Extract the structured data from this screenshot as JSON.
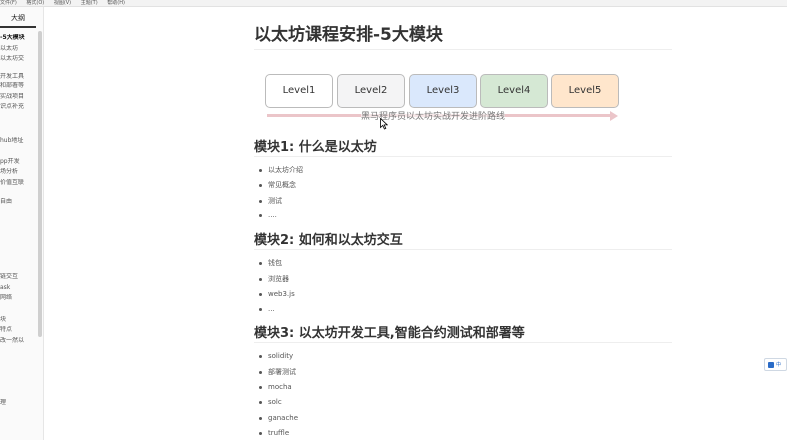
{
  "menubar": {
    "items": [
      "文件(F)",
      "格式(O)",
      "视图(V)",
      "主题(T)",
      "帮助(H)"
    ]
  },
  "sidebar": {
    "tab_label": "大纲",
    "items": [
      {
        "label": "-5大模块",
        "active": true
      },
      {
        "label": "以太坊"
      },
      {
        "label": "以太坊交"
      },
      {
        "label": "开发工具"
      },
      {
        "label": "和部署等"
      },
      {
        "label": "实战项目"
      },
      {
        "label": "识点补充"
      },
      {
        "label": "hub地址"
      },
      {
        "label": "pp开发"
      },
      {
        "label": "场分析"
      },
      {
        "label": "价值互联"
      },
      {
        "label": "自由"
      },
      {
        "label": "链交互"
      },
      {
        "label": "ask"
      },
      {
        "label": "网络"
      },
      {
        "label": "块"
      },
      {
        "label": "特点"
      },
      {
        "label": "改一然以"
      },
      {
        "label": "理"
      }
    ]
  },
  "document": {
    "title": "以太坊课程安排-5大模块",
    "levels": [
      {
        "label": "Level1",
        "color": "#ffffff"
      },
      {
        "label": "Level2",
        "color": "#f4f4f5"
      },
      {
        "label": "Level3",
        "color": "#dae8fc"
      },
      {
        "label": "Level4",
        "color": "#d5e8d4"
      },
      {
        "label": "Level5",
        "color": "#ffe6cc"
      }
    ],
    "arrow_text": "黑马程序员以太坊实战开发进阶路线",
    "modules": [
      {
        "heading": "模块1: 什么是以太坊",
        "items": [
          "以太坊介绍",
          "常见概念",
          "测试",
          "...."
        ]
      },
      {
        "heading": "模块2: 如何和以太坊交互",
        "items": [
          "钱包",
          "浏览器",
          "web3.js",
          "..."
        ]
      },
      {
        "heading": "模块3: 以太坊开发工具,智能合约测试和部署等",
        "items": [
          "solidity",
          "部署测试",
          "mocha",
          "solc",
          "ganache",
          "truffle"
        ]
      }
    ]
  },
  "widget": {
    "label": "中"
  }
}
